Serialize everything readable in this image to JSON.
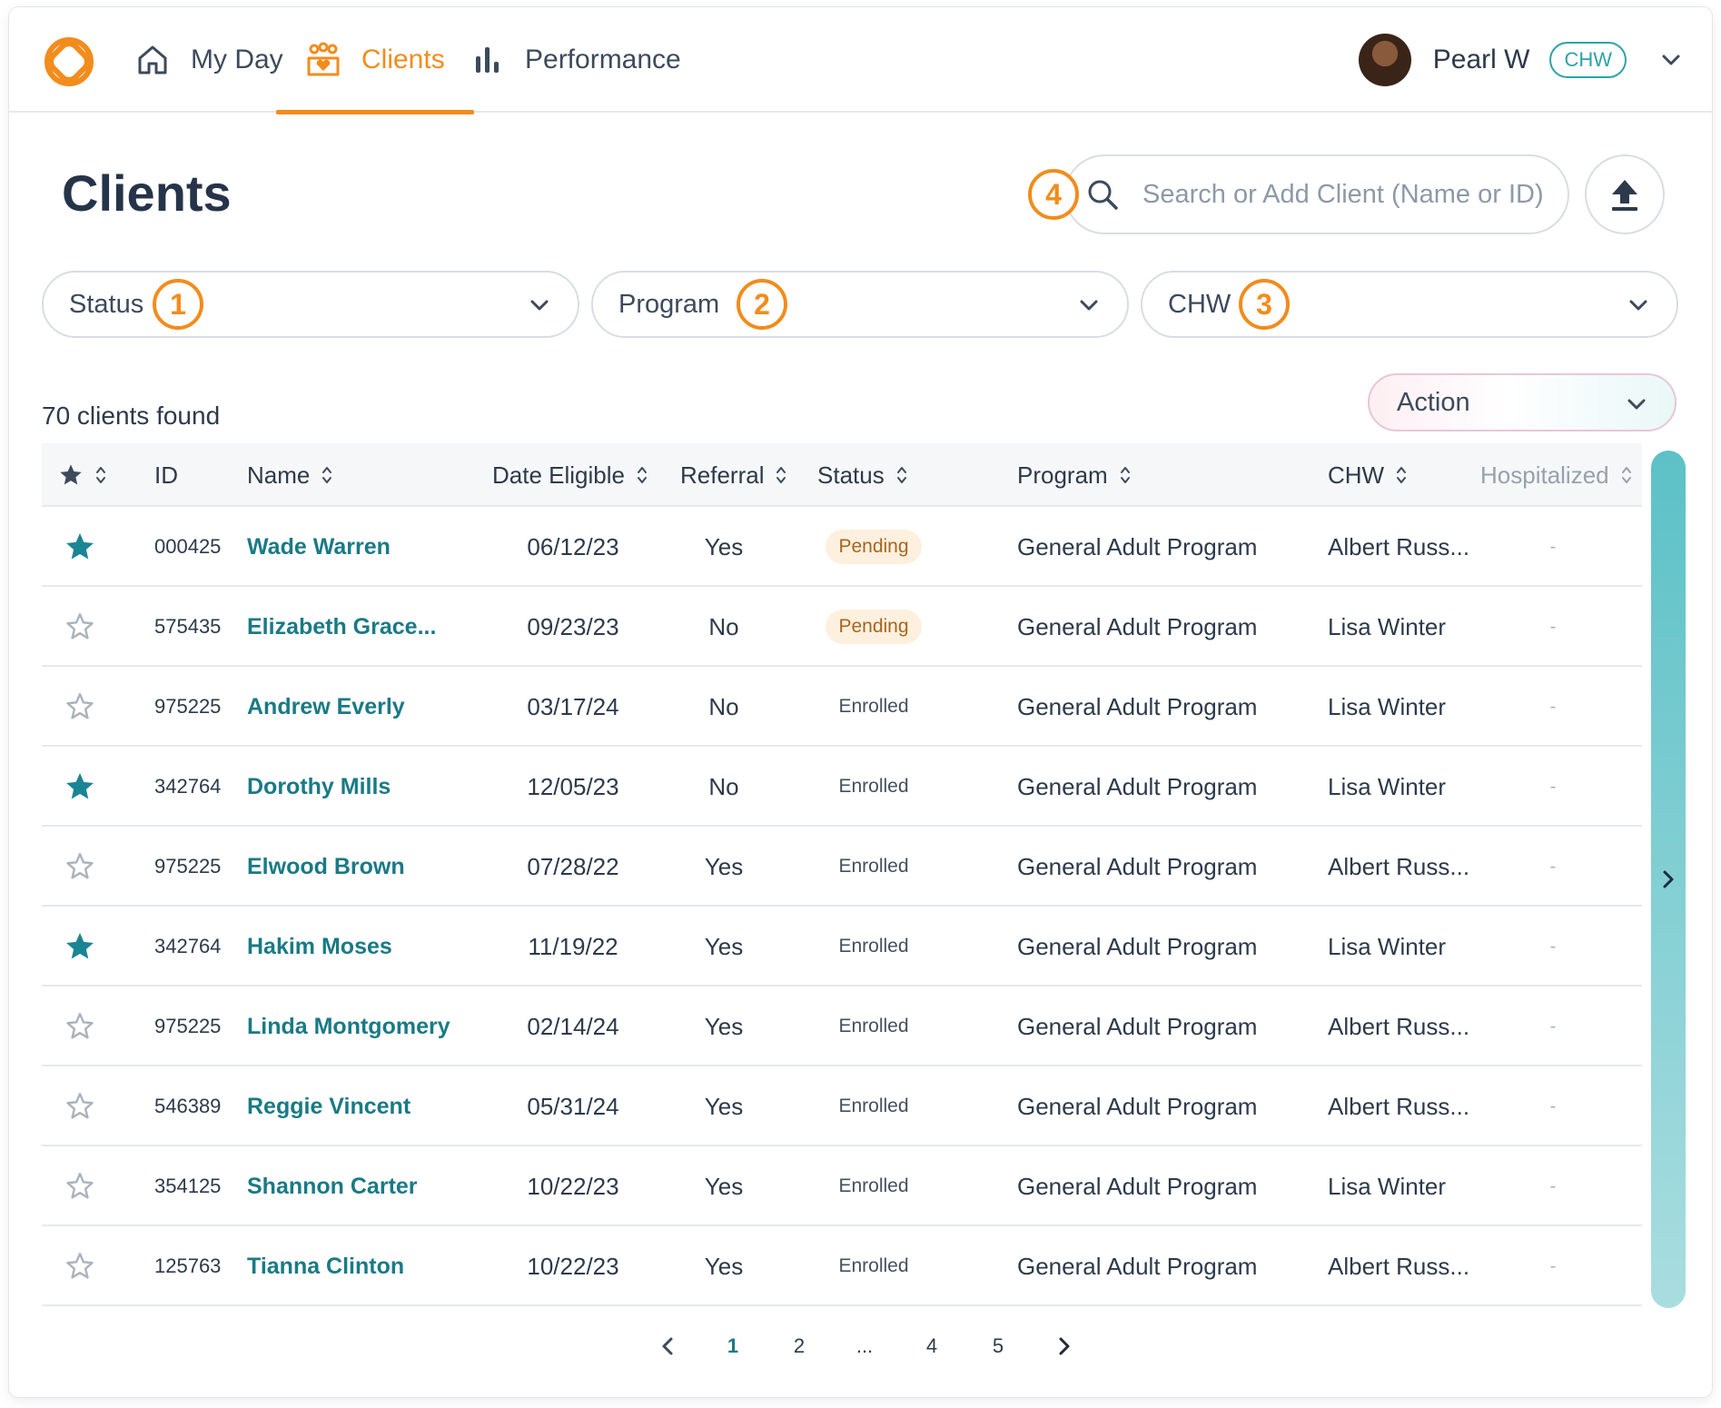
{
  "brand": {
    "accent": "#f28c1c",
    "teal": "#197a86"
  },
  "nav": {
    "items": [
      {
        "label": "My Day",
        "icon": "home-icon"
      },
      {
        "label": "Clients",
        "icon": "people-heart-icon",
        "active": true
      },
      {
        "label": "Performance",
        "icon": "bar-chart-icon"
      }
    ],
    "user": {
      "name": "Pearl W",
      "role": "CHW"
    }
  },
  "page": {
    "title": "Clients"
  },
  "search": {
    "placeholder": "Search or Add Client (Name or ID)",
    "value": ""
  },
  "badges": [
    "1",
    "2",
    "3",
    "4"
  ],
  "filters": [
    {
      "label": "Status"
    },
    {
      "label": "Program"
    },
    {
      "label": "CHW"
    }
  ],
  "summary": {
    "found": "70 clients found"
  },
  "action": {
    "label": "Action"
  },
  "table": {
    "columns": [
      "ID",
      "Name",
      "Date Eligible",
      "Referral",
      "Status",
      "Program",
      "CHW",
      "Hospitalized"
    ],
    "rows": [
      {
        "starred": true,
        "id": "000425",
        "name": "Wade Warren",
        "date": "06/12/23",
        "referral": "Yes",
        "status": "Pending",
        "program": "General Adult Program",
        "chw": "Albert Russ...",
        "hosp": "-"
      },
      {
        "starred": false,
        "id": "575435",
        "name": "Elizabeth Grace...",
        "date": "09/23/23",
        "referral": "No",
        "status": "Pending",
        "program": "General Adult Program",
        "chw": "Lisa Winter",
        "hosp": "-"
      },
      {
        "starred": false,
        "id": "975225",
        "name": "Andrew Everly",
        "date": "03/17/24",
        "referral": "No",
        "status": "Enrolled",
        "program": "General Adult Program",
        "chw": "Lisa Winter",
        "hosp": "-"
      },
      {
        "starred": true,
        "id": "342764",
        "name": "Dorothy Mills",
        "date": "12/05/23",
        "referral": "No",
        "status": "Enrolled",
        "program": "General Adult Program",
        "chw": "Lisa Winter",
        "hosp": "-"
      },
      {
        "starred": false,
        "id": "975225",
        "name": "Elwood Brown",
        "date": "07/28/22",
        "referral": "Yes",
        "status": "Enrolled",
        "program": "General Adult Program",
        "chw": "Albert Russ...",
        "hosp": "-"
      },
      {
        "starred": true,
        "id": "342764",
        "name": "Hakim Moses",
        "date": "11/19/22",
        "referral": "Yes",
        "status": "Enrolled",
        "program": "General Adult Program",
        "chw": "Lisa Winter",
        "hosp": "-"
      },
      {
        "starred": false,
        "id": "975225",
        "name": "Linda Montgomery",
        "date": "02/14/24",
        "referral": "Yes",
        "status": "Enrolled",
        "program": "General Adult Program",
        "chw": "Albert Russ...",
        "hosp": "-"
      },
      {
        "starred": false,
        "id": "546389",
        "name": "Reggie Vincent",
        "date": "05/31/24",
        "referral": "Yes",
        "status": "Enrolled",
        "program": "General Adult Program",
        "chw": "Albert Russ...",
        "hosp": "-"
      },
      {
        "starred": false,
        "id": "354125",
        "name": "Shannon Carter",
        "date": "10/22/23",
        "referral": "Yes",
        "status": "Enrolled",
        "program": "General Adult Program",
        "chw": "Lisa Winter",
        "hosp": "-"
      },
      {
        "starred": false,
        "id": "125763",
        "name": "Tianna Clinton",
        "date": "10/22/23",
        "referral": "Yes",
        "status": "Enrolled",
        "program": "General Adult Program",
        "chw": "Albert Russ...",
        "hosp": "-"
      }
    ]
  },
  "pagination": {
    "pages": [
      "1",
      "2",
      "...",
      "4",
      "5"
    ],
    "current": "1"
  }
}
